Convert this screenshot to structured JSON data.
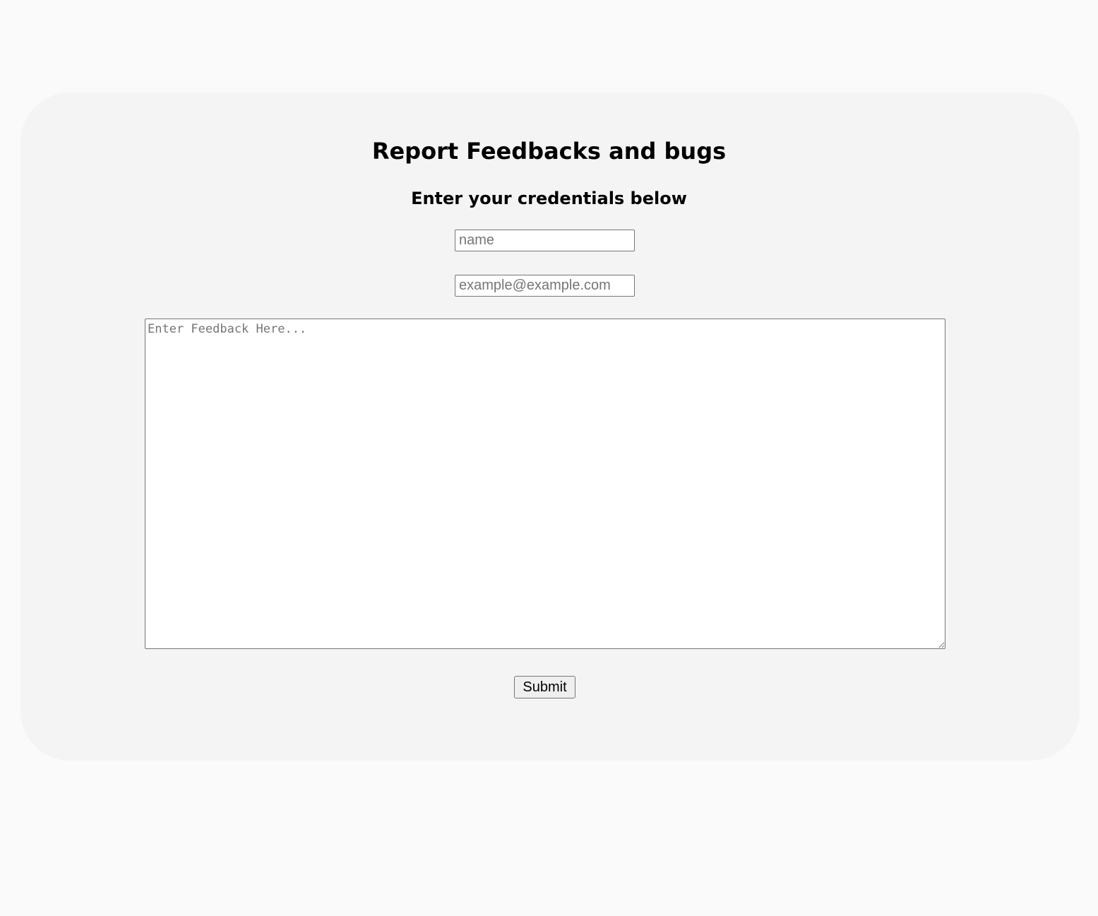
{
  "form": {
    "title": "Report Feedbacks and bugs",
    "subtitle": "Enter your credentials below",
    "name_placeholder": "name",
    "email_placeholder": "example@example.com",
    "feedback_placeholder": "Enter Feedback Here...",
    "submit_label": "Submit"
  },
  "colors": {
    "page_background": "#fafafa",
    "card_background": "#f4f4f4",
    "input_border": "#767676",
    "button_background": "#efefef"
  }
}
